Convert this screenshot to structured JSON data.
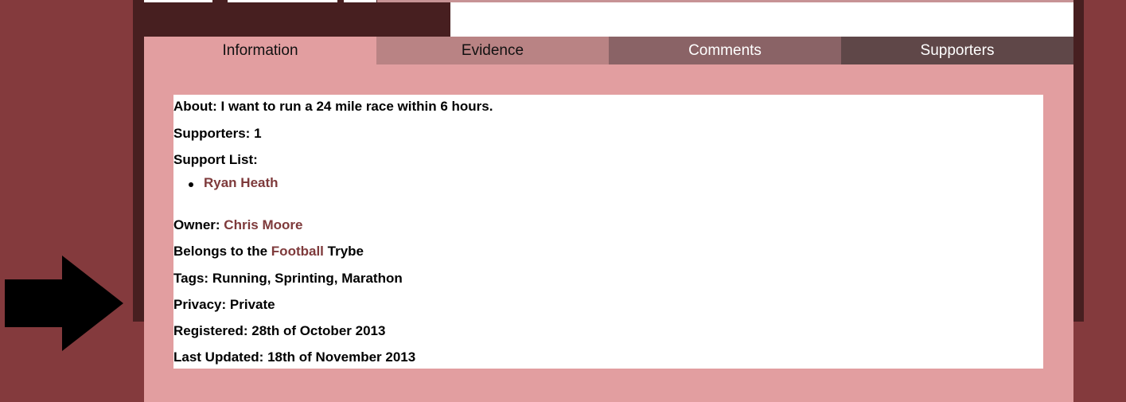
{
  "tabs": [
    {
      "label": "Information"
    },
    {
      "label": "Evidence"
    },
    {
      "label": "Comments"
    },
    {
      "label": "Supporters"
    }
  ],
  "info": {
    "about_label": "About:",
    "about_text": "I want to run a 24 mile race within 6 hours.",
    "supporters_label": "Supporters:",
    "supporters_count": "1",
    "support_list_label": "Support List:",
    "support_list": [
      "Ryan Heath"
    ],
    "owner_label": "Owner:",
    "owner_name": "Chris Moore",
    "belongs_prefix": "Belongs to the",
    "tribe_name": "Football",
    "belongs_suffix": "Trybe",
    "tags_label": "Tags:",
    "tags_text": "Running, Sprinting, Marathon",
    "privacy_label": "Privacy:",
    "privacy_value": "Private",
    "registered_label": "Registered:",
    "registered_value": "28th of October 2013",
    "updated_label": "Last Updated:",
    "updated_value": "18th of November 2013"
  },
  "colors": {
    "page_bg": "#843a3d",
    "panel_bg": "#471f20",
    "content_bg": "#e29ea0",
    "link": "#7e3a3b"
  },
  "icons": {
    "arrow": "right-arrow-icon"
  }
}
